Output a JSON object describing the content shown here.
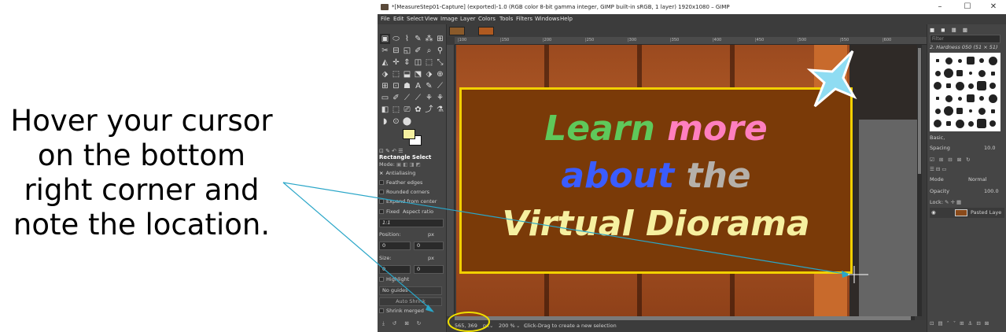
{
  "instruction": {
    "text": "Hover your cursor\non the bottom\nright corner and\nnote the location."
  },
  "window": {
    "title": "*[MeasureStep01-Capture] (exported)-1.0 (RGB color 8-bit gamma integer, GIMP built-in sRGB, 1 layer) 1920x1080 – GIMP",
    "minimize": "–",
    "maximize": "☐",
    "close": "✕"
  },
  "menu": [
    "File",
    "Edit",
    "Select",
    "View",
    "Image",
    "Layer",
    "Colors",
    "Tools",
    "Filters",
    "Windows",
    "Help"
  ],
  "tools": [
    "▣",
    "⬭",
    "⌇",
    "✎",
    "⁂",
    "⊞",
    "✂",
    "⊟",
    "◱",
    "✐",
    "⌕",
    "⚲",
    "◭",
    "✛",
    "⇕",
    "◫",
    "⬚",
    "⤡",
    "⬗",
    "⬚",
    "⬓",
    "⬔",
    "⬗",
    "⊕",
    "⊞",
    "⊡",
    "☗",
    "A",
    "✎",
    "⟋",
    "▭",
    "✐",
    "⟋",
    "⟋",
    "⚘",
    "⚘",
    "◧",
    "⬚",
    "⎚",
    "✿",
    "⤴",
    "⚗",
    "◗",
    "⊙",
    "⬤"
  ],
  "tool_options": {
    "tabs": "⊡ ✎ ↶ ☰",
    "title": "Rectangle Select",
    "mode": "Mode:",
    "antialiasing": "Antialiasing",
    "feather": "Feather edges",
    "rounded": "Rounded corners",
    "expand": "Expand from center",
    "fixed": "Fixed",
    "aspect": "Aspect ratio",
    "ratio_value": "1:1",
    "position_label": "Position:",
    "position_unit": "px",
    "position_x": "0",
    "position_y": "0",
    "size_label": "Size:",
    "size_unit": "px",
    "size_w": "0",
    "size_h": "0",
    "highlight": "Highlight",
    "guides": "No guides",
    "auto_shrink": "Auto Shrink",
    "shrink_merged": "Shrink merged"
  },
  "image_text": {
    "line1_a": "Learn",
    "line1_b": "more",
    "line2_a": "about",
    "line2_b": "the",
    "line3": "Virtual Diorama"
  },
  "ruler_ticks": [
    "|100",
    "|150",
    "|200",
    "|250",
    "|300",
    "|350",
    "|400",
    "|450",
    "|500",
    "|550",
    "|600"
  ],
  "statusbar": {
    "coords": "565, 369",
    "unit": "px",
    "zoom": "200 %",
    "message": "Click-Drag to create a new selection"
  },
  "dock": {
    "filter_placeholder": "Filter",
    "brush_name": "2. Hardness 050 (51 × 51)",
    "preset": "Basic,",
    "spacing_label": "Spacing",
    "spacing_value": "10.0",
    "mode_label": "Mode",
    "mode_value": "Normal",
    "opacity_label": "Opacity",
    "opacity_value": "100.0",
    "lock_label": "Lock:",
    "layer_name": "Pasted Laye"
  },
  "colors": {
    "sign_border": "#f2d000",
    "sign_fill": "#7a3a08",
    "learn": "#5fc85a",
    "more": "#ff7fbf",
    "about": "#3a5cff",
    "the": "#b5b0aa",
    "virtual": "#f6f0a0",
    "star": "#8fdcf2",
    "annotation": "#2aa6c8",
    "highlight_circle": "#f0e000"
  }
}
